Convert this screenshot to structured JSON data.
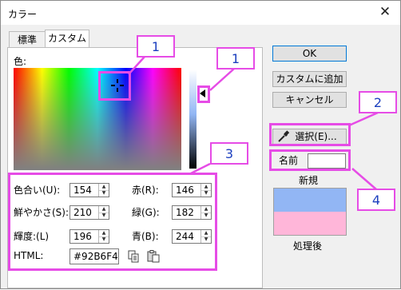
{
  "window": {
    "title": "カラー",
    "close_glyph": "✕"
  },
  "tabs": [
    {
      "label": "標準"
    },
    {
      "label": "カスタム"
    }
  ],
  "custom": {
    "color_label": "色:",
    "hue": {
      "label": "色合い(U):",
      "value": "154"
    },
    "sat": {
      "label": "鮮やかさ(S):",
      "value": "210"
    },
    "lum": {
      "label": "輝度:(L)",
      "value": "196"
    },
    "red": {
      "label": "赤(R):",
      "value": "146"
    },
    "green": {
      "label": "緑(G):",
      "value": "182"
    },
    "blue": {
      "label": "青(B):",
      "value": "244"
    },
    "html": {
      "label": "HTML:",
      "value": "#92B6F4"
    }
  },
  "buttons": {
    "ok": "OK",
    "add_custom": "カスタムに追加",
    "cancel": "キャンセル",
    "select": "選択(E)..."
  },
  "name": {
    "label": "名前",
    "value": ""
  },
  "preview": {
    "new_label": "新規",
    "processed_label": "処理後",
    "new_color": "#92B6F4",
    "processed_color": "#FFB6D9"
  },
  "callouts": [
    "1",
    "1",
    "2",
    "3",
    "4"
  ],
  "accent_color": "#E64CE6",
  "callout_text_color": "#1C3FBF"
}
